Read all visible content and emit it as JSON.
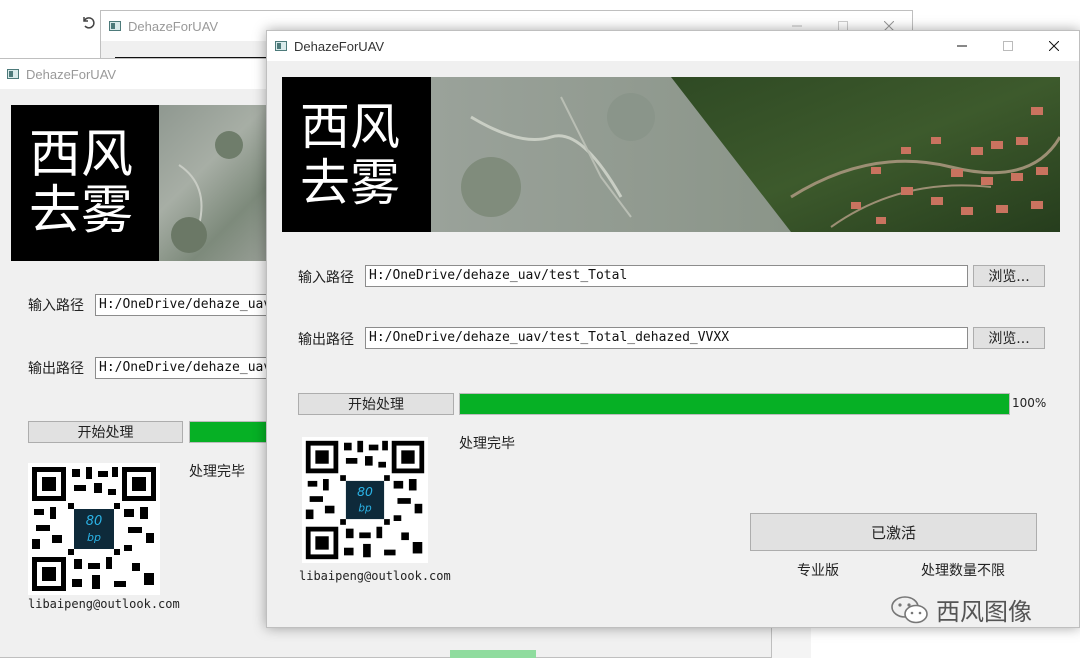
{
  "toolbar": {
    "undo_icon": "undo-icon"
  },
  "back_window_1": {
    "title": "DehazeForUAV"
  },
  "back_window_2": {
    "title": "DehazeForUAV",
    "logo_line1": "西风",
    "logo_line2": "去雾",
    "input_label": "输入路径",
    "input_value": "H:/OneDrive/dehaze_uav",
    "output_label": "输出路径",
    "output_value": "H:/OneDrive/dehaze_uav",
    "start_button": "开始处理",
    "status": "处理完毕",
    "qr_badge": "80 bp",
    "email": "libaipeng@outlook.com"
  },
  "main_window": {
    "title": "DehazeForUAV",
    "logo_line1": "西风",
    "logo_line2": "去雾",
    "input_label": "输入路径",
    "input_value": "H:/OneDrive/dehaze_uav/test_Total",
    "browse_label": "浏览...",
    "output_label": "输出路径",
    "output_value": "H:/OneDrive/dehaze_uav/test_Total_dehazed_VVXX",
    "start_button": "开始处理",
    "progress": 100,
    "progress_text": "100%",
    "progress_color": "#06b025",
    "status": "处理完毕",
    "activated_button": "已激活",
    "edition": "专业版",
    "limit": "处理数量不限",
    "qr_badge": "80 bp",
    "email": "libaipeng@outlook.com"
  },
  "watermark": {
    "text": "西风图像",
    "icon": "wechat-icon"
  }
}
